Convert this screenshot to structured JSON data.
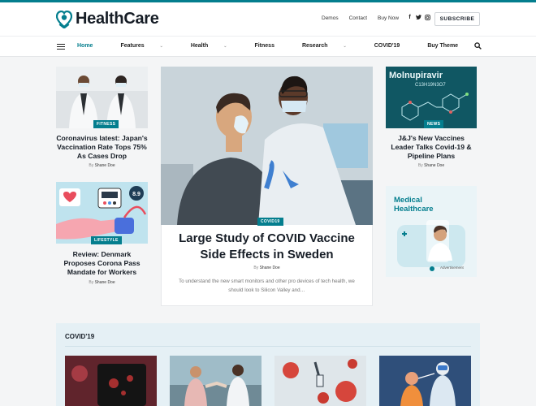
{
  "brand": {
    "name": "HealthCare",
    "accent": "#047e8e"
  },
  "topnav": {
    "items": [
      "Demos",
      "Contact",
      "Buy Now"
    ]
  },
  "social": [
    "f",
    "t",
    "i"
  ],
  "subscribe_label": "SUBSCRIBE",
  "menu": {
    "items": [
      {
        "label": "Home"
      },
      {
        "label": "Features",
        "caret": "⌄"
      },
      {
        "label": "Health",
        "caret": "⌄"
      },
      {
        "label": "Fitness"
      },
      {
        "label": "Research",
        "caret": "⌄"
      },
      {
        "label": "COVID'19"
      },
      {
        "label": "Buy Theme"
      }
    ]
  },
  "cards": {
    "left1": {
      "tag": "FITNESS",
      "title": "Coronavirus latest: Japan's Vaccination Rate Tops 75% As Cases Drop",
      "by": "By",
      "author": "Shane Doe"
    },
    "left2": {
      "tag": "LIFESTYLE",
      "title": "Review: Denmark Proposes Corona Pass Mandate for Workers",
      "by": "By",
      "author": "Shane Doe",
      "badge": "8.9"
    },
    "feature": {
      "tag": "COVID19",
      "title": "Large Study of COVID Vaccine Side Effects in Sweden",
      "by": "By",
      "author": "Shane Doe",
      "excerpt": "To understand the new smart monitors and other pro devices of tech health, we should look to Silicon Valley and…"
    },
    "right1": {
      "tag": "NEWS",
      "title": "J&J's New Vaccines Leader Talks Covid-19 & Pipeline Plans",
      "by": "By",
      "author": "Shane Doe",
      "image_text": "Molnupiravir",
      "formula": "C13H19N3O7"
    }
  },
  "ad": {
    "line1": "Medical",
    "line2": "Healthcare",
    "label": "Advertisement"
  },
  "section": {
    "title": "COVID'19"
  }
}
